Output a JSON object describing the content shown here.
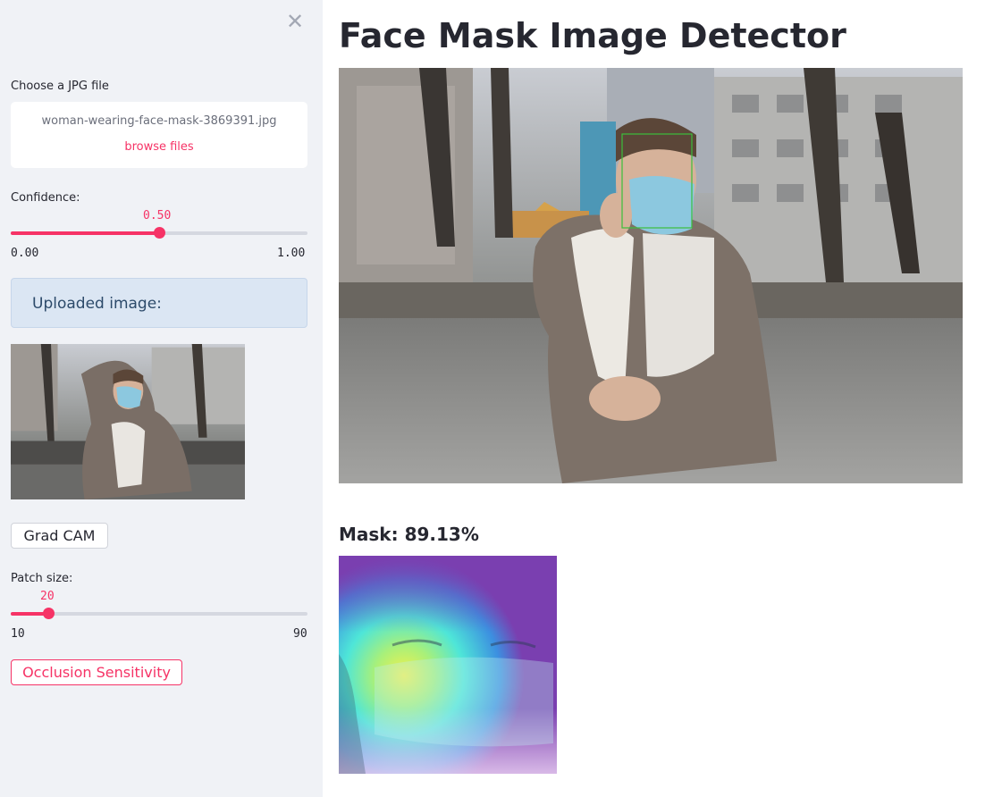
{
  "sidebar": {
    "uploader": {
      "label": "Choose a JPG file",
      "filename": "woman-wearing-face-mask-3869391.jpg",
      "browse_label": "browse files"
    },
    "confidence": {
      "label": "Confidence:",
      "value": "0.50",
      "min": "0.00",
      "max": "1.00",
      "fraction": 0.5
    },
    "info_text": "Uploaded image:",
    "gradcam_label": "Grad CAM",
    "patch": {
      "label": "Patch size:",
      "value": "20",
      "min": "10",
      "max": "90",
      "fraction": 0.125
    },
    "occlusion_label": "Occlusion Sensitivity",
    "close_icon": "close-icon"
  },
  "main": {
    "title": "Face Mask Image Detector",
    "mask_result": "Mask: 89.13%"
  },
  "colors": {
    "accent": "#f63366",
    "sidebar_bg": "#f0f2f6",
    "info_bg": "#dbe6f3",
    "detection_box": "#3bbf3b"
  }
}
